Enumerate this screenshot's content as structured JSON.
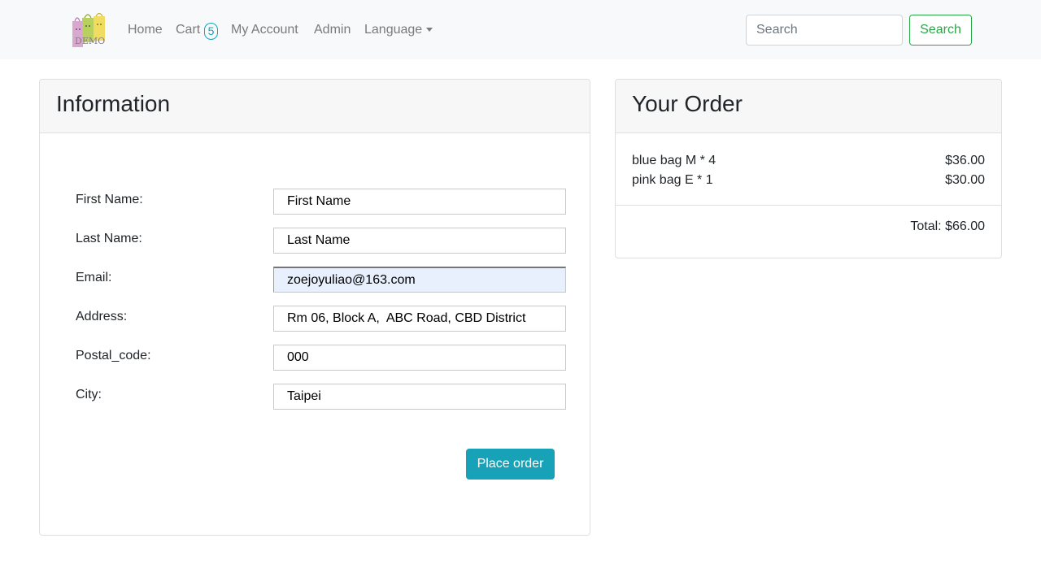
{
  "navbar": {
    "logo_text": "DEMO",
    "links": {
      "home": "Home",
      "cart": "Cart",
      "account": "My Account",
      "admin": "Admin",
      "language": "Language"
    },
    "cart_count": "5",
    "search_placeholder": "Search",
    "search_button": "Search"
  },
  "information": {
    "title": "Information",
    "fields": {
      "first_name": {
        "label": "First Name:",
        "value": "First Name"
      },
      "last_name": {
        "label": "Last Name:",
        "value": "Last Name"
      },
      "email": {
        "label": "Email:",
        "value": "zoejoyuliao@163.com"
      },
      "address": {
        "label": "Address:",
        "value": "Rm 06, Block A,  ABC Road, CBD District"
      },
      "postal_code": {
        "label": "Postal_code:",
        "value": "000"
      },
      "city": {
        "label": "City:",
        "value": "Taipei"
      }
    },
    "place_order": "Place order"
  },
  "order": {
    "title": "Your Order",
    "items": [
      {
        "name": "blue bag M * 4",
        "price": "$36.00"
      },
      {
        "name": "pink bag E * 1",
        "price": "$30.00"
      }
    ],
    "total": "Total: $66.00"
  },
  "colors": {
    "navbar_bg": "#f8f9fa",
    "info": "#17a2b8",
    "success": "#28a745",
    "autofill_bg": "#e8f0fe"
  }
}
